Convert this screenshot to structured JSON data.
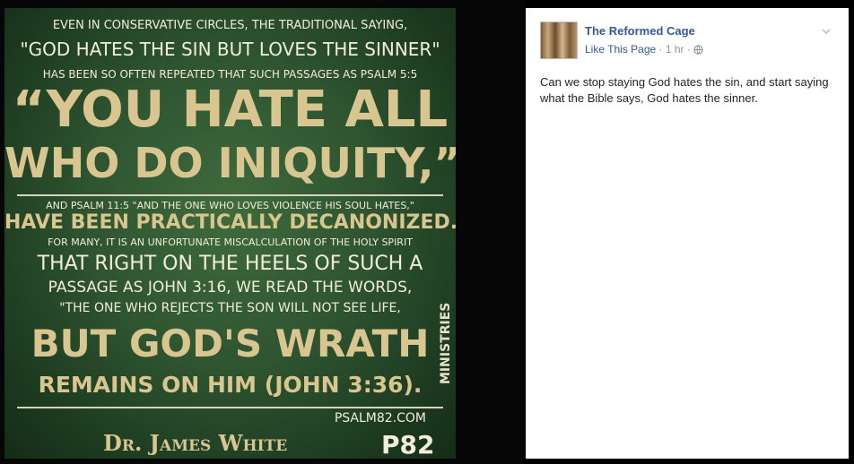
{
  "meme": {
    "lines": [
      "EVEN IN CONSERVATIVE CIRCLES, THE TRADITIONAL SAYING,",
      "\"GOD HATES THE SIN BUT LOVES THE SINNER\"",
      "HAS BEEN SO OFTEN REPEATED THAT SUCH PASSAGES AS PSALM 5:5",
      "“YOU HATE ALL",
      "WHO DO INIQUITY,”",
      "AND PSALM 11:5 \"AND THE ONE WHO LOVES VIOLENCE HIS SOUL HATES,\"",
      "HAVE BEEN PRACTICALLY DECANONIZED.",
      "FOR MANY, IT IS AN UNFORTUNATE MISCALCULATION OF THE HOLY SPIRIT",
      "THAT RIGHT ON THE HEELS OF SUCH A",
      "PASSAGE AS JOHN 3:16, WE READ THE WORDS,",
      "\"THE ONE WHO REJECTS THE SON WILL NOT SEE LIFE,",
      "BUT GOD'S WRATH",
      "REMAINS ON HIM (JOHN 3:36)."
    ],
    "website": "PSALM82.COM",
    "author": "Dr. James White",
    "logo": "P82",
    "ministries": "MINISTRIES"
  },
  "post": {
    "page_name": "The Reformed Cage",
    "like_label": "Like This Page",
    "separator": " · ",
    "time": "1 hr",
    "privacy_icon": "globe-icon",
    "menu_icon": "chevron-down-icon",
    "text": "Can we stop staying God hates the sin, and start saying what the Bible says, God hates the sinner."
  },
  "colors": {
    "link": "#365899",
    "meta": "#90949c",
    "meme_bg": "#2e5430",
    "meme_tan": "#d9c58f"
  }
}
